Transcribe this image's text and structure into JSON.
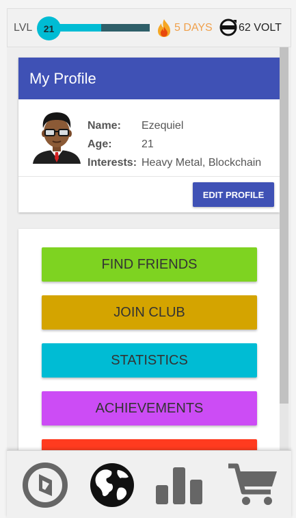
{
  "status": {
    "level_label": "LVL",
    "level_value": "21",
    "level_progress": 0.52,
    "streak_text": "5 DAYS",
    "volt_text": "62 VOLT",
    "icons": {
      "streak": "fire-icon",
      "volt": "volt-logo-icon"
    }
  },
  "profile": {
    "title": "My Profile",
    "fields": [
      {
        "key": "Name:",
        "value": "Ezequiel"
      },
      {
        "key": "Age:",
        "value": "21"
      },
      {
        "key": "Interests:",
        "value": "Heavy Metal, Blockchain"
      }
    ],
    "edit_label": "EDIT PROFILE",
    "avatar": "avatar-icon"
  },
  "menu": {
    "buttons": [
      {
        "label": "FIND FRIENDS",
        "color": "#7ed321"
      },
      {
        "label": "JOIN CLUB",
        "color": "#d4a400"
      },
      {
        "label": "STATISTICS",
        "color": "#00bcd4"
      },
      {
        "label": "ACHIEVEMENTS",
        "color": "#cc4cf5"
      },
      {
        "label": "",
        "color": "#ff3b1f"
      }
    ]
  },
  "nav": {
    "items": [
      {
        "name": "music-disc-icon"
      },
      {
        "name": "globe-icon",
        "active": true
      },
      {
        "name": "bar-chart-icon"
      },
      {
        "name": "cart-icon"
      }
    ]
  },
  "colors": {
    "primary": "#3f51b5",
    "accent": "#00bcd4",
    "streak": "#f0a04b"
  }
}
